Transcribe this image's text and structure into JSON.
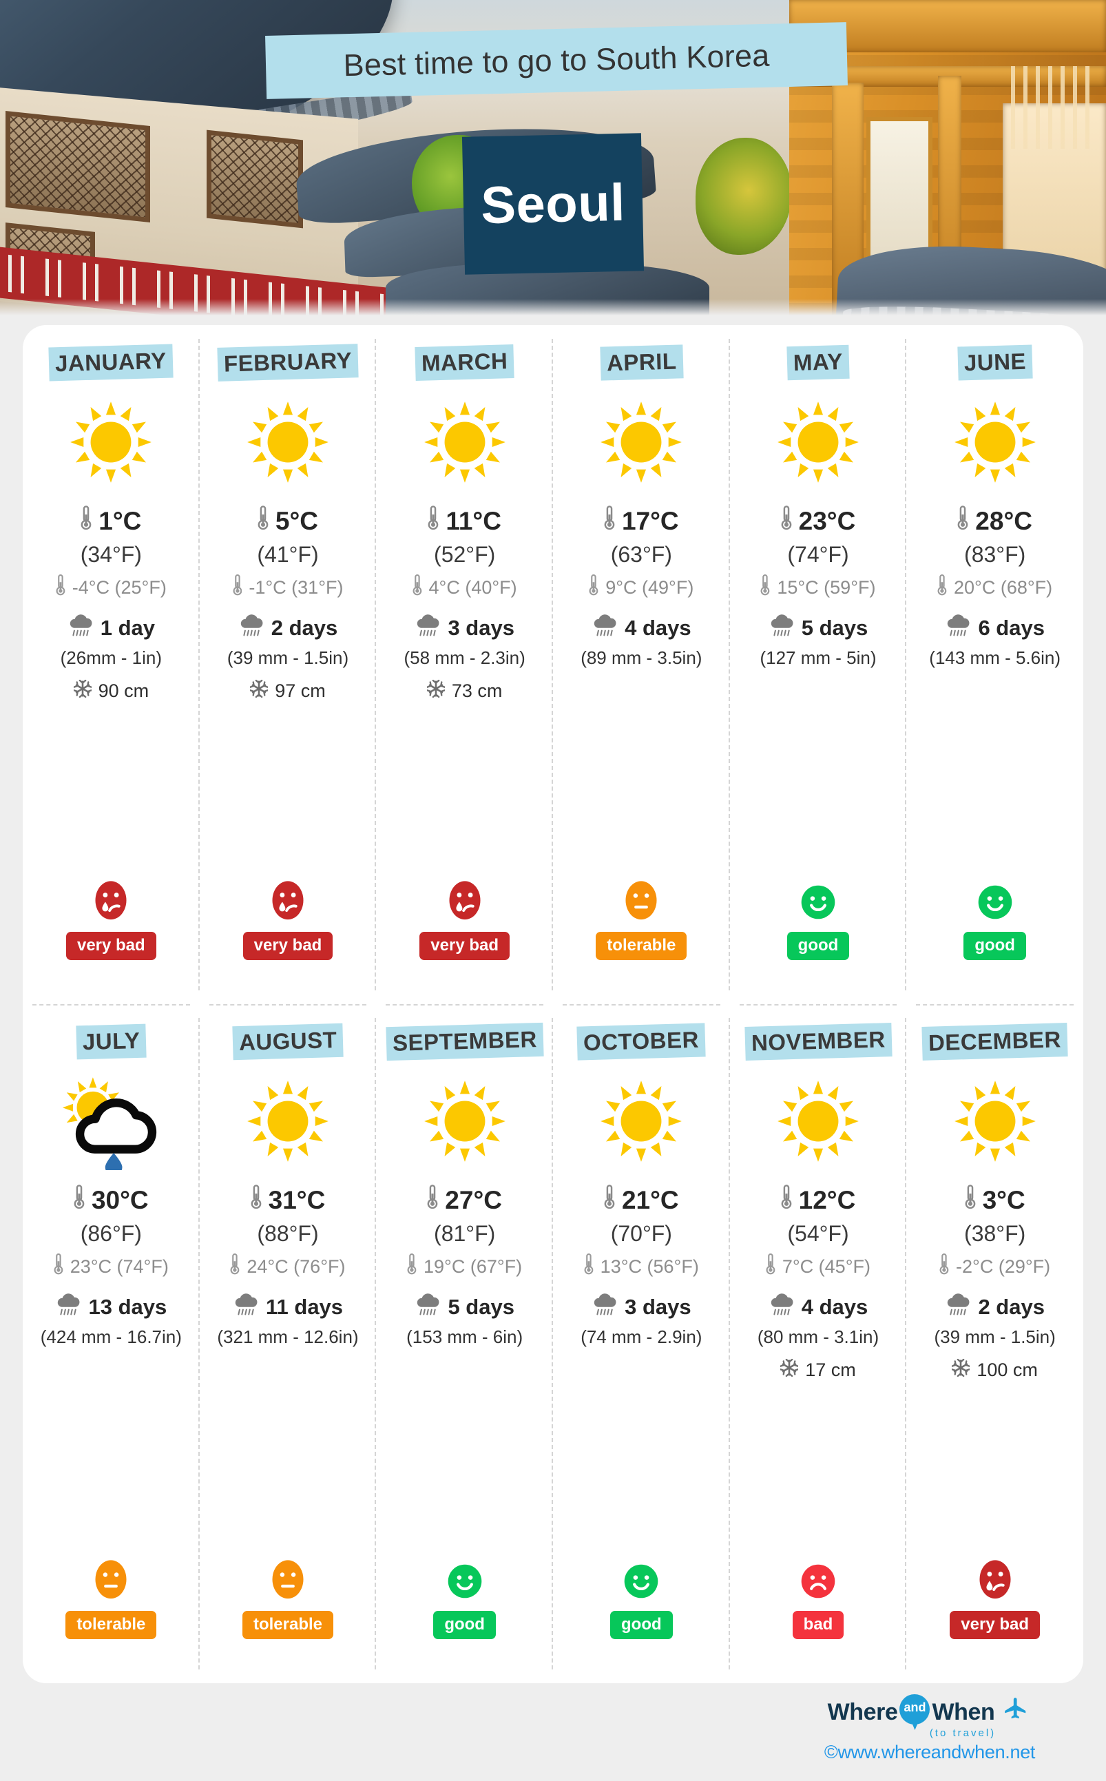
{
  "hero": {
    "banner_title": "Best time to go to South Korea",
    "city": "Seoul"
  },
  "footer": {
    "logo_where": "Where",
    "logo_and": "and",
    "logo_when": "When",
    "logo_sub": "(to travel)",
    "url": "©www.whereandwhen.net",
    "plane_icon": "airplane-icon",
    "pin_icon": "location-pin-icon"
  },
  "colors": {
    "banner_blue": "#b3dfec",
    "city_navy": "#14425f",
    "verybad_red": "#c62828",
    "bad_red": "#f4333d",
    "tolerable_orange": "#f79009",
    "good_green": "#07c75a",
    "sun_yellow": "#fcc800",
    "icon_grey": "#808080",
    "raindrop_blue": "#2d6fb0"
  },
  "labels": {
    "thermometer_icon": "thermometer-icon",
    "rain_icon": "rain-cloud-icon",
    "snow_icon": "snowflake-icon",
    "sun_icon": "sun-icon",
    "sun_cloud_rain_icon": "sun-cloud-rain-icon"
  },
  "chart_data": {
    "type": "table",
    "title": "Best time to go to South Korea — Seoul",
    "columns": [
      "month",
      "weather_icon",
      "high_c",
      "high_f",
      "low_c",
      "low_f",
      "rain_days",
      "rain_mm",
      "rain_in",
      "snow_cm",
      "verdict"
    ],
    "months": [
      {
        "name": "JANUARY",
        "icon": "sun",
        "high_c": "1°C",
        "high_f": "(34°F)",
        "low": "-4°C (25°F)",
        "rain_days": "1 day",
        "rain_amount": "(26mm - 1in)",
        "snow": "90 cm",
        "verdict": "very bad",
        "verdict_class": "verybad",
        "face": "sad-tear"
      },
      {
        "name": "FEBRUARY",
        "icon": "sun",
        "high_c": "5°C",
        "high_f": "(41°F)",
        "low": "-1°C (31°F)",
        "rain_days": "2 days",
        "rain_amount": "(39 mm - 1.5in)",
        "snow": "97 cm",
        "verdict": "very bad",
        "verdict_class": "verybad",
        "face": "sad-tear"
      },
      {
        "name": "MARCH",
        "icon": "sun",
        "high_c": "11°C",
        "high_f": "(52°F)",
        "low": "4°C (40°F)",
        "rain_days": "3 days",
        "rain_amount": "(58 mm - 2.3in)",
        "snow": "73 cm",
        "verdict": "very bad",
        "verdict_class": "verybad",
        "face": "sad-tear"
      },
      {
        "name": "APRIL",
        "icon": "sun",
        "high_c": "17°C",
        "high_f": "(63°F)",
        "low": "9°C (49°F)",
        "rain_days": "4 days",
        "rain_amount": "(89 mm - 3.5in)",
        "snow": "",
        "verdict": "tolerable",
        "verdict_class": "tolerable",
        "face": "neutral"
      },
      {
        "name": "MAY",
        "icon": "sun",
        "high_c": "23°C",
        "high_f": "(74°F)",
        "low": "15°C (59°F)",
        "rain_days": "5 days",
        "rain_amount": "(127 mm - 5in)",
        "snow": "",
        "verdict": "good",
        "verdict_class": "good",
        "face": "happy"
      },
      {
        "name": "JUNE",
        "icon": "sun",
        "high_c": "28°C",
        "high_f": "(83°F)",
        "low": "20°C (68°F)",
        "rain_days": "6 days",
        "rain_amount": "(143 mm - 5.6in)",
        "snow": "",
        "verdict": "good",
        "verdict_class": "good",
        "face": "happy"
      },
      {
        "name": "JULY",
        "icon": "sun-cloud-rain",
        "high_c": "30°C",
        "high_f": "(86°F)",
        "low": "23°C (74°F)",
        "rain_days": "13 days",
        "rain_amount": "(424 mm - 16.7in)",
        "snow": "",
        "verdict": "tolerable",
        "verdict_class": "tolerable",
        "face": "neutral"
      },
      {
        "name": "AUGUST",
        "icon": "sun",
        "high_c": "31°C",
        "high_f": "(88°F)",
        "low": "24°C (76°F)",
        "rain_days": "11 days",
        "rain_amount": "(321 mm - 12.6in)",
        "snow": "",
        "verdict": "tolerable",
        "verdict_class": "tolerable",
        "face": "neutral"
      },
      {
        "name": "SEPTEMBER",
        "icon": "sun",
        "high_c": "27°C",
        "high_f": "(81°F)",
        "low": "19°C (67°F)",
        "rain_days": "5 days",
        "rain_amount": "(153 mm - 6in)",
        "snow": "",
        "verdict": "good",
        "verdict_class": "good",
        "face": "happy"
      },
      {
        "name": "OCTOBER",
        "icon": "sun",
        "high_c": "21°C",
        "high_f": "(70°F)",
        "low": "13°C (56°F)",
        "rain_days": "3 days",
        "rain_amount": "(74 mm - 2.9in)",
        "snow": "",
        "verdict": "good",
        "verdict_class": "good",
        "face": "happy"
      },
      {
        "name": "NOVEMBER",
        "icon": "sun",
        "high_c": "12°C",
        "high_f": "(54°F)",
        "low": "7°C (45°F)",
        "rain_days": "4 days",
        "rain_amount": "(80 mm - 3.1in)",
        "snow": "17 cm",
        "verdict": "bad",
        "verdict_class": "bad",
        "face": "sad"
      },
      {
        "name": "DECEMBER",
        "icon": "sun",
        "high_c": "3°C",
        "high_f": "(38°F)",
        "low": "-2°C (29°F)",
        "rain_days": "2 days",
        "rain_amount": "(39 mm - 1.5in)",
        "snow": "100 cm",
        "verdict": "very bad",
        "verdict_class": "verybad",
        "face": "sad-tear"
      }
    ]
  }
}
